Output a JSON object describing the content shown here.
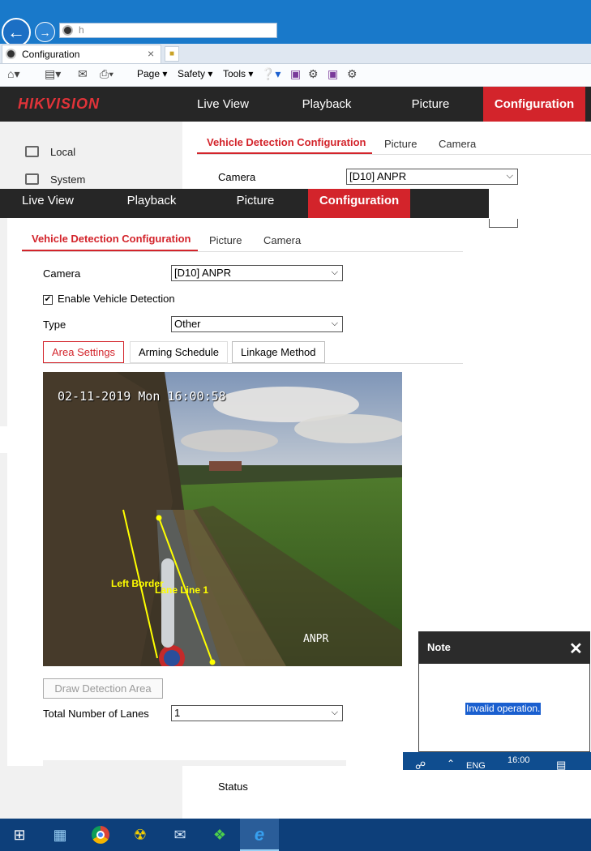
{
  "browser": {
    "address": "h",
    "tab_title": "Configuration",
    "tab_close": "×",
    "menu": {
      "page": "Page",
      "safety": "Safety",
      "tools": "Tools"
    }
  },
  "app": {
    "logo": "HIKVISION",
    "nav": [
      "Live View",
      "Playback",
      "Picture",
      "Configuration"
    ],
    "sidebar": [
      {
        "label": "Local",
        "icon": "monitor-icon"
      },
      {
        "label": "System",
        "icon": "system-icon"
      }
    ],
    "subtabs": [
      "Vehicle Detection Configuration",
      "Picture",
      "Camera"
    ],
    "back_camera_label": "Camera",
    "back_camera_value": "[D10] ANPR",
    "status_label": "Status"
  },
  "overlay": {
    "nav": [
      "Live View",
      "Playback",
      "Picture",
      "Configuration"
    ],
    "subtabs": [
      "Vehicle Detection Configuration",
      "Picture",
      "Camera"
    ],
    "camera_label": "Camera",
    "camera_value": "[D10] ANPR",
    "enable_label": "Enable Vehicle Detection",
    "enable_checked": true,
    "type_label": "Type",
    "type_value": "Other",
    "settings_tabs": [
      "Area Settings",
      "Arming Schedule",
      "Linkage Method"
    ],
    "video": {
      "timestamp": "02-11-2019 Mon 16:00:58",
      "channel_name": "ANPR",
      "line1": "Left Border",
      "line2": "Lane Line 1"
    },
    "draw_button": "Draw Detection Area",
    "lanes_label": "Total Number of Lanes",
    "lanes_value": "1"
  },
  "note": {
    "title": "Note",
    "message": "Invalid operation."
  },
  "tray": {
    "lang": "ENG",
    "time": "16:00"
  },
  "colors": {
    "accent_red": "#d3242b",
    "nav_dark": "#262626",
    "ie_blue": "#1979ca",
    "taskbar": "#0d3f7a"
  }
}
